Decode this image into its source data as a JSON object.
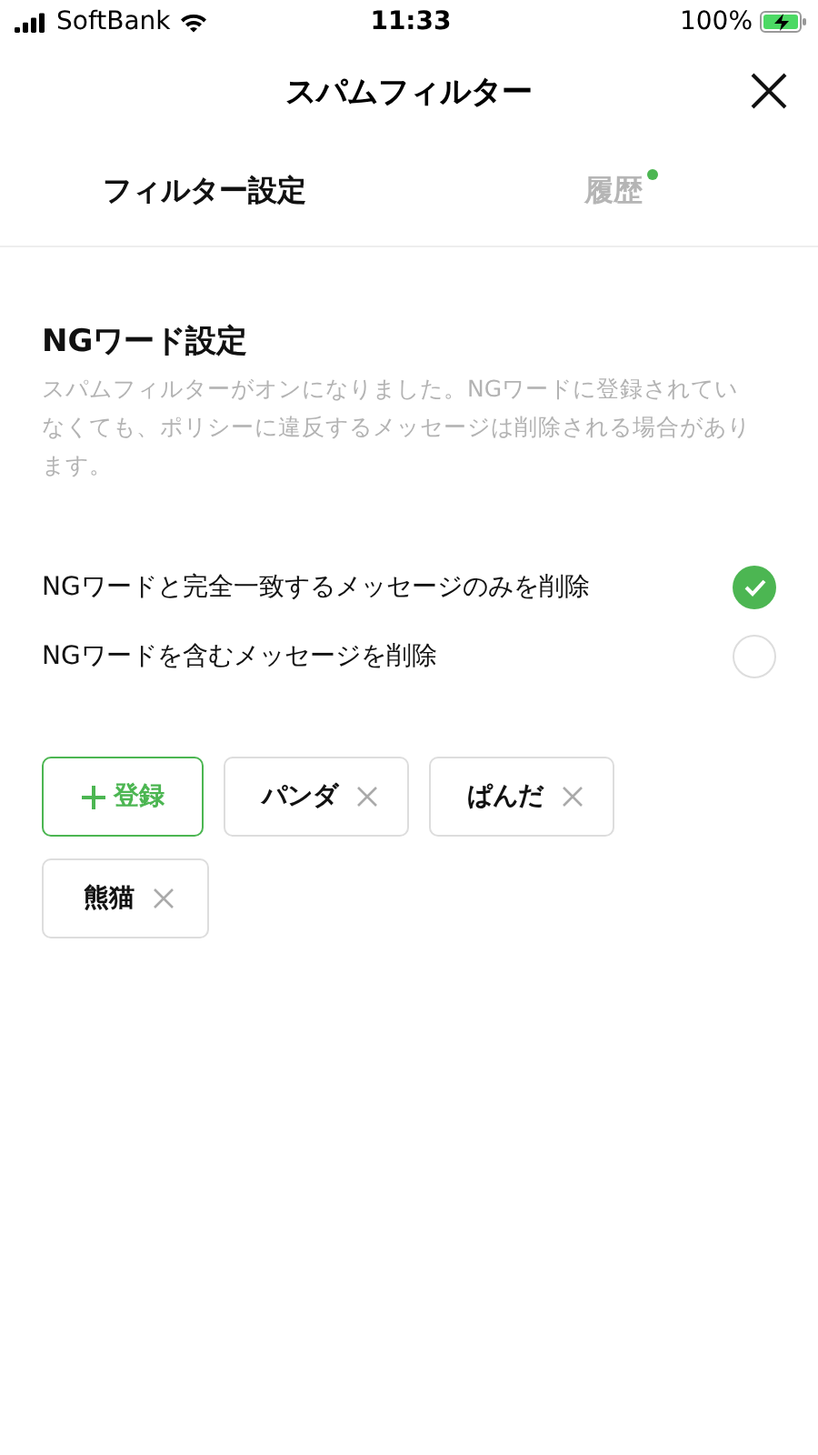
{
  "status_bar": {
    "carrier": "SoftBank",
    "time": "11:33",
    "battery": "100%"
  },
  "header": {
    "title": "スパムフィルター"
  },
  "tabs": [
    {
      "label": "フィルター設定",
      "selected": true,
      "badge": false
    },
    {
      "label": "履歴",
      "selected": false,
      "badge": true
    }
  ],
  "section": {
    "title": "NGワード設定",
    "description": "スパムフィルターがオンになりました。NGワードに登録されていなくても、ポリシーに違反するメッセージは削除される場合があります。"
  },
  "options": [
    {
      "label": "NGワードと完全一致するメッセージのみを削除",
      "selected": true
    },
    {
      "label": "NGワードを含むメッセージを削除",
      "selected": false
    }
  ],
  "add_button": {
    "label": "登録"
  },
  "words": [
    "パンダ",
    "ぱんだ",
    "熊猫"
  ]
}
